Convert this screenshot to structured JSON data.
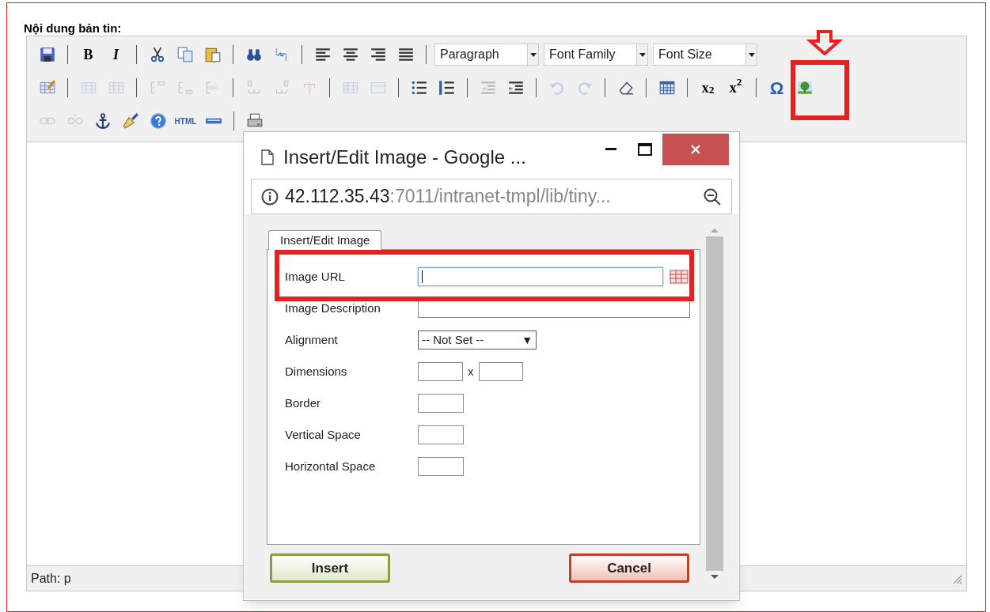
{
  "field_label": "Nội dung bản tin:",
  "toolbar": {
    "rows": [
      [
        {
          "kind": "button",
          "disabled": false
        },
        {
          "kind": "separator"
        },
        {
          "kind": "text",
          "label": "B",
          "disabled": false
        },
        {
          "kind": "text",
          "label": "I",
          "disabled": false
        },
        {
          "kind": "separator"
        },
        {
          "kind": "button",
          "disabled": false
        },
        {
          "kind": "button",
          "disabled": false
        },
        {
          "kind": "button",
          "disabled": false
        },
        {
          "kind": "separator"
        },
        {
          "kind": "button",
          "disabled": false
        },
        {
          "kind": "button",
          "disabled": false
        },
        {
          "kind": "separator"
        },
        {
          "kind": "button",
          "disabled": false
        },
        {
          "kind": "button",
          "disabled": false
        },
        {
          "kind": "button",
          "disabled": false
        },
        {
          "kind": "button",
          "disabled": false
        },
        {
          "kind": "separator"
        },
        {
          "kind": "select",
          "label": "Paragraph"
        },
        {
          "kind": "select",
          "label": "Font Family"
        },
        {
          "kind": "select",
          "label": "Font Size"
        }
      ],
      [
        {
          "kind": "button",
          "disabled": false
        },
        {
          "kind": "separator"
        },
        {
          "kind": "button",
          "disabled": true
        },
        {
          "kind": "button",
          "disabled": true
        },
        {
          "kind": "separator"
        },
        {
          "kind": "button",
          "disabled": true
        },
        {
          "kind": "button",
          "disabled": true
        },
        {
          "kind": "button",
          "disabled": true
        },
        {
          "kind": "separator"
        },
        {
          "kind": "button",
          "disabled": true
        },
        {
          "kind": "button",
          "disabled": true
        },
        {
          "kind": "button",
          "disabled": true
        },
        {
          "kind": "separator"
        },
        {
          "kind": "button",
          "disabled": true
        },
        {
          "kind": "button",
          "disabled": true
        },
        {
          "kind": "separator"
        },
        {
          "kind": "button",
          "disabled": false
        },
        {
          "kind": "button",
          "disabled": false
        },
        {
          "kind": "separator"
        },
        {
          "kind": "button",
          "disabled": true
        },
        {
          "kind": "button",
          "disabled": false
        },
        {
          "kind": "separator"
        },
        {
          "kind": "button",
          "disabled": true
        },
        {
          "kind": "button",
          "disabled": true
        },
        {
          "kind": "separator"
        },
        {
          "kind": "button",
          "disabled": false
        },
        {
          "kind": "separator"
        },
        {
          "kind": "button",
          "disabled": false
        },
        {
          "kind": "separator"
        },
        {
          "kind": "text",
          "label": "x$_{2}$",
          "disabled": false
        },
        {
          "kind": "text",
          "label": "x$^{2}$",
          "disabled": false
        },
        {
          "kind": "separator"
        },
        {
          "kind": "text",
          "label": "Ω",
          "disabled": false
        },
        {
          "kind": "button",
          "disabled": false
        }
      ],
      [
        {
          "kind": "button",
          "disabled": true
        },
        {
          "kind": "button",
          "disabled": true
        },
        {
          "kind": "button",
          "disabled": false
        },
        {
          "kind": "button",
          "disabled": false
        },
        {
          "kind": "button",
          "disabled": false
        },
        {
          "kind": "text",
          "label": "HTML",
          "disabled": false
        },
        {
          "kind": "button",
          "disabled": false
        },
        {
          "kind": "separator"
        },
        {
          "kind": "button",
          "disabled": false
        }
      ]
    ]
  },
  "status_bar": {
    "path": "Path: p"
  },
  "dialog": {
    "title": "Insert/Edit Image - Google ...",
    "address_host": "42.112.35.43",
    "address_rest": ":7011/intranet-tmpl/lib/tiny...",
    "tabs": [
      {
        "label": "Insert/Edit Image",
        "selected": true
      }
    ],
    "fields": [
      {
        "kind": "text",
        "label": "Image URL",
        "focused": true,
        "browse": true
      },
      {
        "kind": "text",
        "label": "Image Description",
        "focused": false,
        "browse": false
      },
      {
        "kind": "select",
        "label": "Alignment",
        "value": "-- Not Set --",
        "arrow": "▼"
      },
      {
        "kind": "pair",
        "label": "Dimensions",
        "separator": "x"
      },
      {
        "kind": "small",
        "label": "Border"
      },
      {
        "kind": "small",
        "label": "Vertical Space"
      },
      {
        "kind": "small",
        "label": "Horizontal Space"
      }
    ],
    "buttons": [
      {
        "label": "Insert",
        "kind": "primary"
      },
      {
        "label": "Cancel",
        "kind": "cancel"
      }
    ]
  }
}
